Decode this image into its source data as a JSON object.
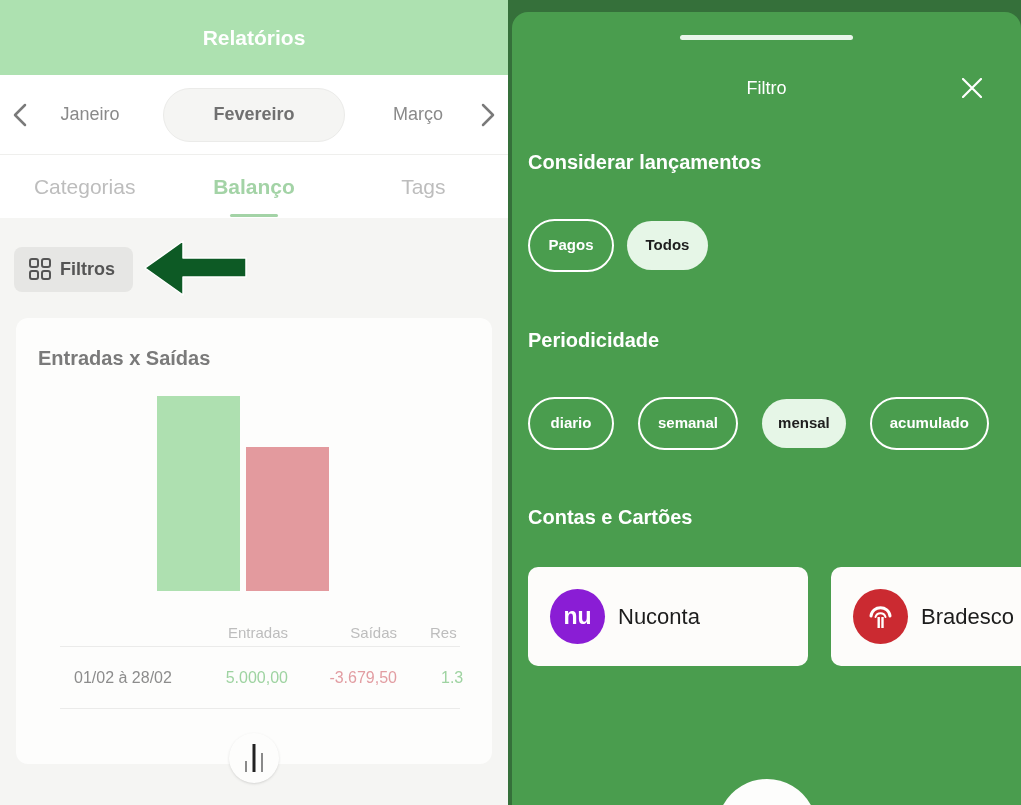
{
  "header": {
    "title": "Relatórios"
  },
  "months": [
    {
      "label": "Janeiro",
      "selected": false
    },
    {
      "label": "Fevereiro",
      "selected": true
    },
    {
      "label": "Março",
      "selected": false
    }
  ],
  "tabs": [
    {
      "label": "Categorias",
      "selected": false
    },
    {
      "label": "Balanço",
      "selected": true
    },
    {
      "label": "Tags",
      "selected": false
    }
  ],
  "filters_button": {
    "label": "Filtros"
  },
  "balance_card": {
    "title": "Entradas x Saídas",
    "table": {
      "columns": [
        "",
        "Entradas",
        "Saídas",
        "Res"
      ],
      "rows": [
        [
          "01/02 à 28/02",
          "5.000,00",
          "-3.679,50",
          "1.3"
        ]
      ]
    }
  },
  "filter_sheet": {
    "title": "Filtro",
    "sections": [
      {
        "kind": "chips",
        "title": "Considerar lançamentos",
        "options": [
          {
            "label": "Pagos",
            "selected": false
          },
          {
            "label": "Todos",
            "selected": true
          }
        ]
      },
      {
        "kind": "chips",
        "title": "Periodicidade",
        "options": [
          {
            "label": "diario",
            "selected": false
          },
          {
            "label": "semanal",
            "selected": false
          },
          {
            "label": "mensal",
            "selected": true
          },
          {
            "label": "acumulado",
            "selected": false
          }
        ]
      },
      {
        "kind": "accounts",
        "title": "Contas e Cartões",
        "accounts": [
          {
            "kind": "letters",
            "logo_text": "nu",
            "name": "Nuconta",
            "color": "#8a1dd5"
          },
          {
            "kind": "symbol",
            "name": "Bradesco",
            "color": "#cb2a31"
          }
        ]
      }
    ]
  }
}
